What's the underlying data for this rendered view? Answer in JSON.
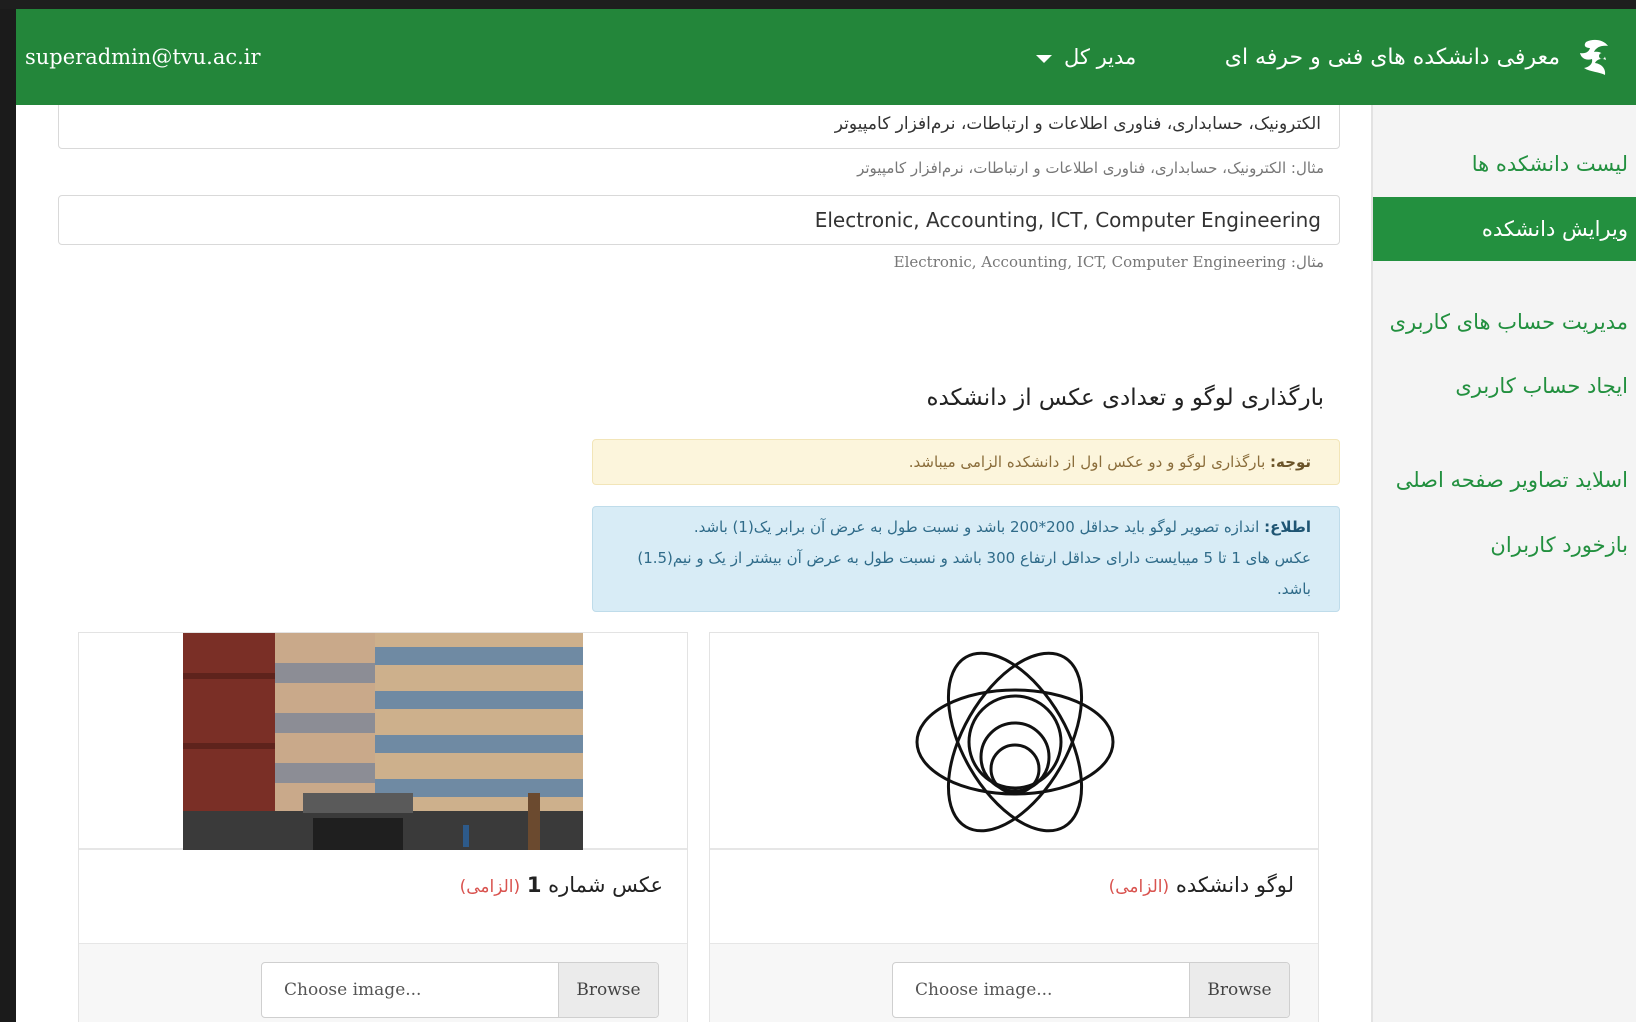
{
  "navbar": {
    "brand_title": "معرفی دانشکده های فنی و حرفه ای",
    "role_label": "مدیر کل",
    "user_email": "superadmin@tvu.ac.ir"
  },
  "sidebar": {
    "items": [
      {
        "label": "لیست دانشکده ها",
        "active": false
      },
      {
        "label": "ویرایش دانشکده",
        "active": true
      },
      {
        "label": "مدیریت حساب های کاربری",
        "active": false
      },
      {
        "label": "ایجاد حساب کاربری",
        "active": false
      },
      {
        "label": "اسلاید تصاویر صفحه اصلی",
        "active": false
      },
      {
        "label": "بازخورد کاربران",
        "active": false
      }
    ]
  },
  "form": {
    "fields_fa_value": "الکترونیک، حسابداری، فناوری اطلاعات و ارتباطات، نرم‌افزار کامپیوتر",
    "fields_fa_help": "مثال: الکترونیک، حسابداری، فناوری اطلاعات و ارتباطات، نرم‌افزار کامپیوتر",
    "fields_en_value": "Electronic, Accounting, ICT, Computer Engineering",
    "fields_en_help": "Electronic, Accounting, ICT, Computer Engineering :مثال"
  },
  "upload_section": {
    "title": "بارگذاری لوگو و تعدادی عکس از دانشکده",
    "warning_label": "توجه:",
    "warning_text": "بارگذاری لوگو و دو عکس اول از دانشکده الزامی میباشد.",
    "info_label": "اطلاع:",
    "info_line1": "اندازه تصویر لوگو باید حداقل 200*200 باشد و نسبت طول به عرض آن برابر یک(1) باشد.",
    "info_line2": "عکس های 1 تا 5 میبایست دارای حداقل ارتفاع 300 باشد و نسبت طول به عرض آن بیشتر از یک و نیم(1.5) باشد."
  },
  "cards": {
    "logo_title": "لوگو دانشکده",
    "logo_required": "(الزامی)",
    "photo1_title_text": "عکس شماره",
    "photo1_title_num": "1",
    "photo1_required": "(الزامی)",
    "file_placeholder": "Choose image...",
    "browse_label": "Browse"
  },
  "colors": {
    "brand_green": "#23863a",
    "sidebar_active": "#23903f",
    "required_red": "#d9534f"
  }
}
